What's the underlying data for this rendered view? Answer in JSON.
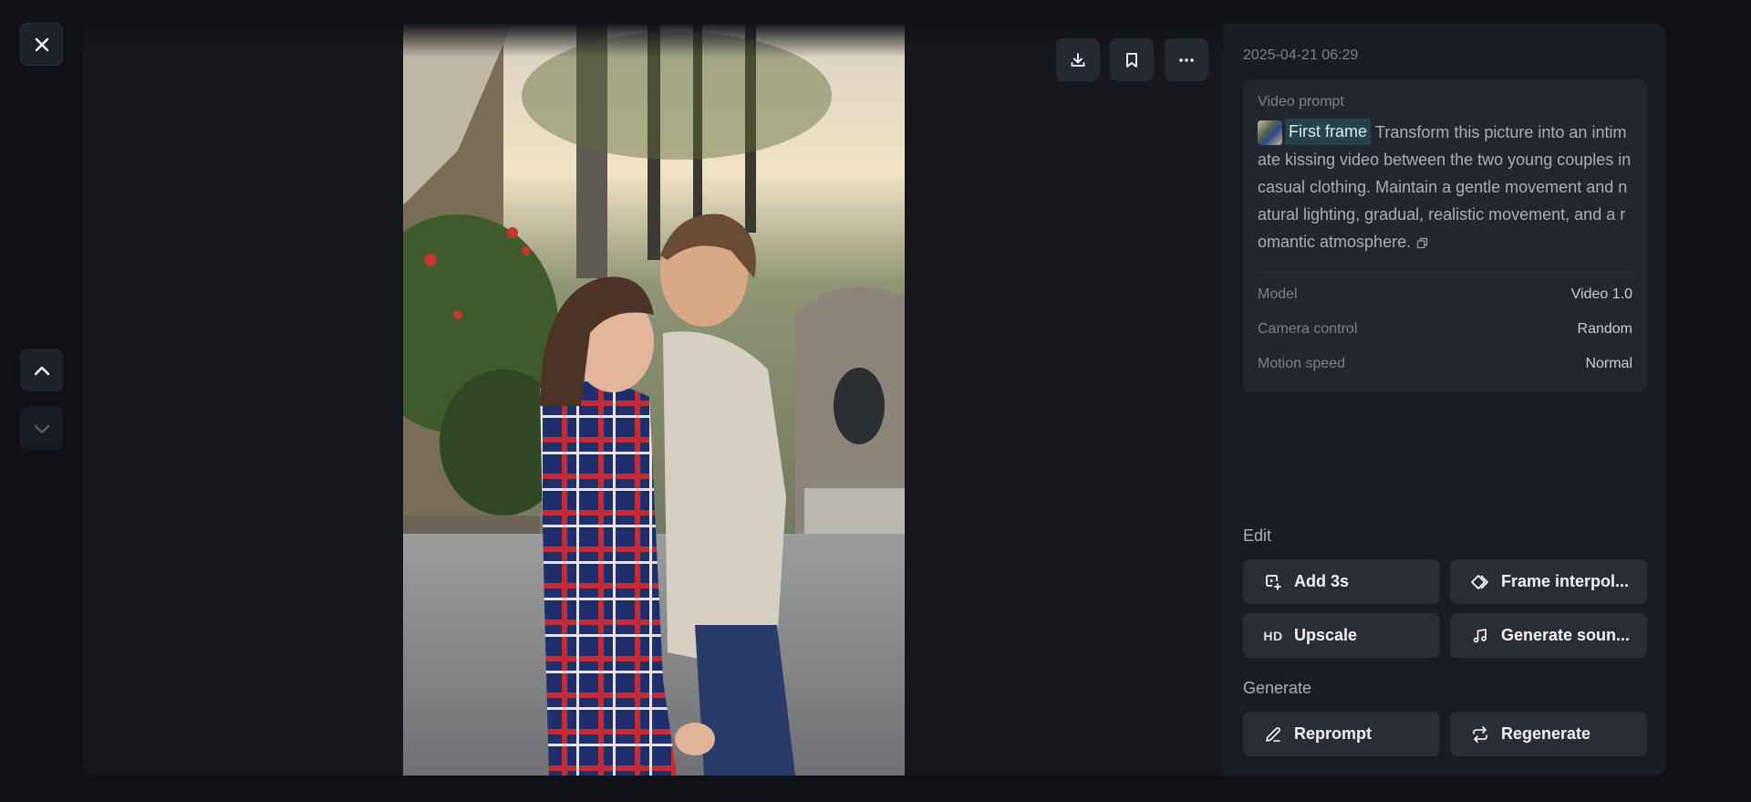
{
  "window": {
    "close_icon": "close-icon",
    "nav_up_icon": "chevron-up-icon",
    "nav_down_icon": "chevron-down-icon"
  },
  "toolbar": {
    "download_icon": "download-icon",
    "bookmark_icon": "bookmark-icon",
    "more_icon": "more-horizontal-icon"
  },
  "details": {
    "timestamp": "2025-04-21 06:29",
    "prompt_title": "Video prompt",
    "first_frame_label": "First frame",
    "prompt_text": "Transform this picture into an intimate kissing video between the two young couples in casual clothing. Maintain a gentle movement and natural lighting, gradual, realistic movement, and a romantic atmosphere.",
    "meta": [
      {
        "key": "Model",
        "value": "Video 1.0"
      },
      {
        "key": "Camera control",
        "value": "Random"
      },
      {
        "key": "Motion speed",
        "value": "Normal"
      }
    ]
  },
  "edit": {
    "title": "Edit",
    "add_label": "Add 3s",
    "interpolation_label": "Frame interpol...",
    "upscale_badge": "HD",
    "upscale_label": "Upscale",
    "sound_label": "Generate soun..."
  },
  "generate": {
    "title": "Generate",
    "reprompt_label": "Reprompt",
    "regenerate_label": "Regenerate"
  },
  "colors": {
    "background": "#0f1116",
    "card": "#16181e",
    "panel": "#1a1c23",
    "button": "#2a2d36",
    "chip": "#26434a"
  }
}
